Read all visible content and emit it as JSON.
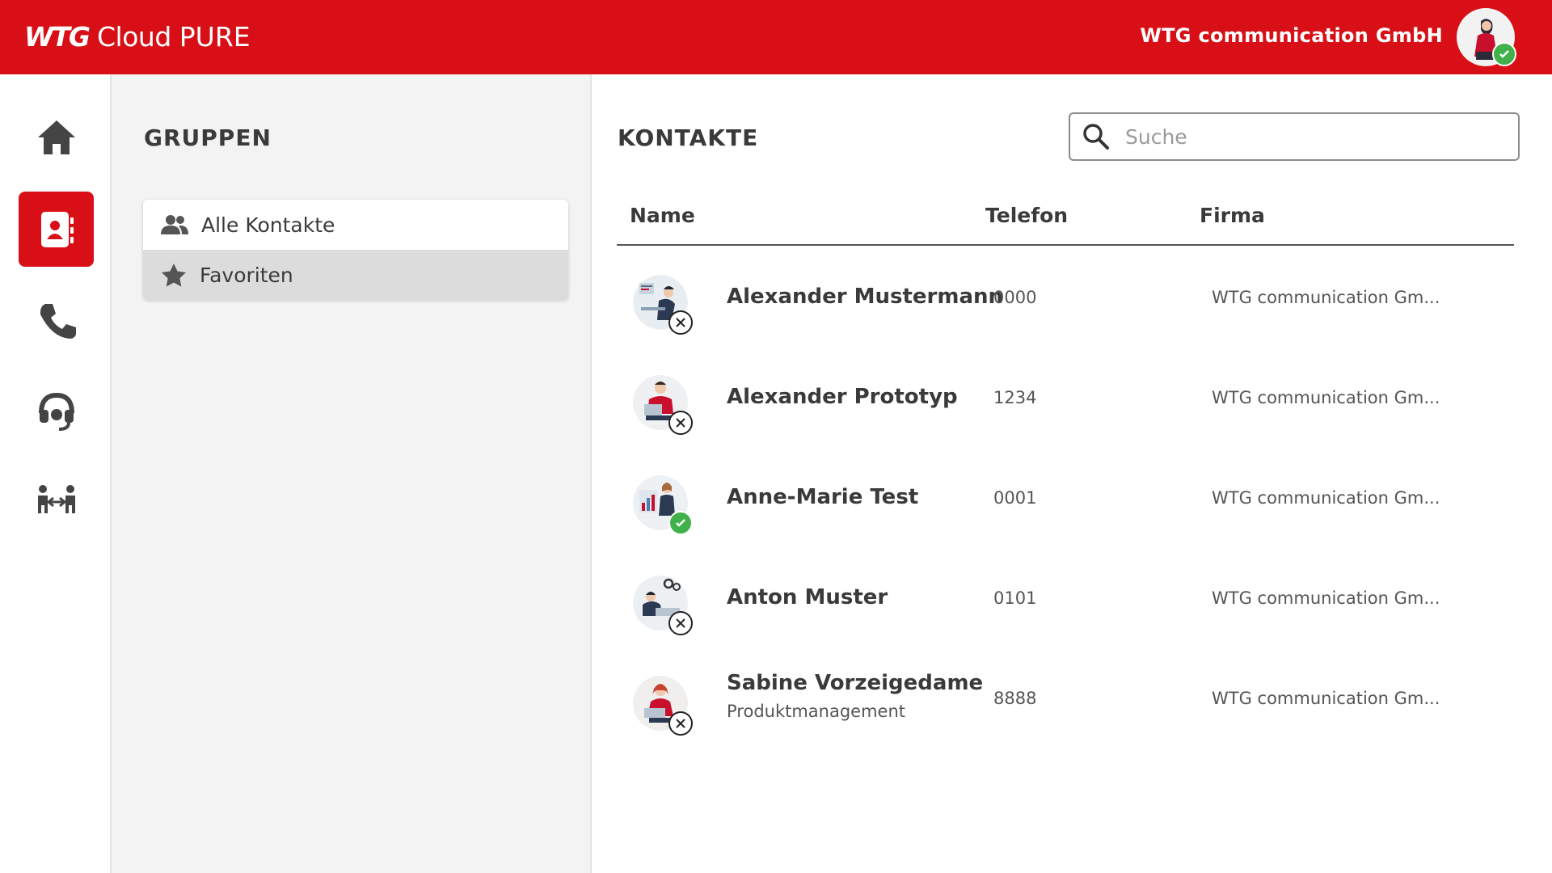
{
  "header": {
    "brand_logo": "WTG",
    "brand_name": "Cloud",
    "brand_product": "PURE",
    "company": "WTG communication GmbH",
    "user_status": "online"
  },
  "rail": {
    "items": [
      {
        "icon": "home-icon",
        "active": false
      },
      {
        "icon": "contacts-icon",
        "active": true
      },
      {
        "icon": "phone-icon",
        "active": false
      },
      {
        "icon": "headset-icon",
        "active": false
      },
      {
        "icon": "transfer-icon",
        "active": false
      }
    ]
  },
  "groups": {
    "title": "GRUPPEN",
    "items": [
      {
        "label": "Alle Kontakte",
        "icon": "people-icon",
        "selected": false
      },
      {
        "label": "Favoriten",
        "icon": "star-icon",
        "selected": true
      }
    ]
  },
  "contacts": {
    "title": "KONTAKTE",
    "search_placeholder": "Suche",
    "columns": [
      "Name",
      "Telefon",
      "Firma"
    ],
    "rows": [
      {
        "name": "Alexander Mustermann",
        "subtitle": "",
        "phone": "0000",
        "company": "WTG communication Gm...",
        "status": "offline"
      },
      {
        "name": "Alexander Prototyp",
        "subtitle": "",
        "phone": "1234",
        "company": "WTG communication Gm...",
        "status": "offline"
      },
      {
        "name": "Anne-Marie Test",
        "subtitle": "",
        "phone": "0001",
        "company": "WTG communication Gm...",
        "status": "online"
      },
      {
        "name": "Anton Muster",
        "subtitle": "",
        "phone": "0101",
        "company": "WTG communication Gm...",
        "status": "offline"
      },
      {
        "name": "Sabine Vorzeigedame",
        "subtitle": "Produktmanagement",
        "phone": "8888",
        "company": "WTG communication Gm...",
        "status": "offline"
      }
    ]
  },
  "colors": {
    "brand_red": "#d80f16",
    "online_green": "#41b24b",
    "panel_gray": "#f3f3f3"
  }
}
